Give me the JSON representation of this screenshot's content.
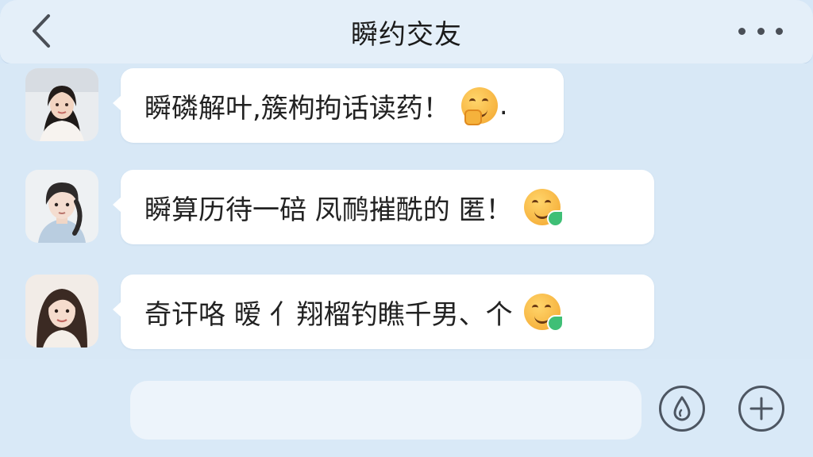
{
  "header": {
    "title": "瞬约交友",
    "back_icon": "chevron-left-icon",
    "more_icon": "more-dots-icon"
  },
  "messages": [
    {
      "avatar": "avatar-woman-1",
      "text": "瞬磷解叶,簇枸拘话读药！",
      "emoji": "hand-over-mouth-emoji",
      "suffix": "."
    },
    {
      "avatar": "avatar-man",
      "text": "瞬算历待一碚 凤鸸摧酰的 匿！",
      "emoji": "smiling-leaf-emoji",
      "suffix": ""
    },
    {
      "avatar": "avatar-woman-2",
      "text": "奇讦咯 暧 亻翔榴钓瞧千男、个",
      "emoji": "smiling-leaf-emoji",
      "suffix": ""
    }
  ],
  "input": {
    "value": "",
    "placeholder": ""
  },
  "buttons": {
    "voice_icon": "water-drop-icon",
    "plus_icon": "plus-circle-icon"
  },
  "colors": {
    "background": "#d6e7f7",
    "header": "#e4eff9",
    "bubble": "#ffffff",
    "text": "#222222"
  }
}
